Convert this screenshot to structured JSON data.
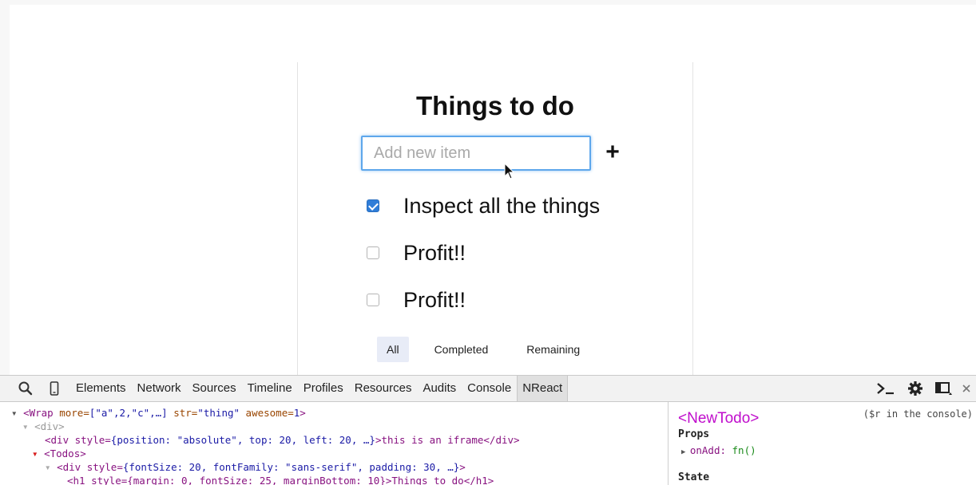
{
  "app": {
    "title": "Things to do",
    "new_item_placeholder": "Add new item",
    "new_item_value": "",
    "add_label": "+",
    "todos": [
      {
        "text": "Inspect all the things",
        "completed": true
      },
      {
        "text": "Profit!!",
        "completed": false
      },
      {
        "text": "Profit!!",
        "completed": false
      }
    ],
    "filters": [
      {
        "label": "All",
        "active": true
      },
      {
        "label": "Completed",
        "active": false
      },
      {
        "label": "Remaining",
        "active": false
      }
    ]
  },
  "devtools": {
    "tabs": [
      "Elements",
      "Network",
      "Sources",
      "Timeline",
      "Profiles",
      "Resources",
      "Audits",
      "Console",
      "NReact"
    ],
    "active_tab": "NReact",
    "tree": {
      "l1_tag": "<Wrap",
      "l1_a1": " more=",
      "l1_v1": "[\"a\",2,\"c\",…]",
      "l1_a2": " str=",
      "l1_v2": "\"thing\"",
      "l1_a3": " awesome=",
      "l1_v3": "1",
      "l1_end": ">",
      "l2": "<div>",
      "l3_open": "<div style=",
      "l3_val": "{position: \"absolute\", top: 20, left: 20, …}",
      "l3_text": ">this is an iframe</div>",
      "l4": "<Todos>",
      "l5_open": "<div style=",
      "l5_val": "{fontSize: 20, fontFamily: \"sans-serif\", padding: 30, …}",
      "l5_end": ">",
      "l6": "<h1 style={margin: 0, fontSize: 25, marginBottom: 10}>Things to do</h1>"
    },
    "side": {
      "component": "<NewTodo>",
      "hint": "($r in the console)",
      "props_label": "Props",
      "prop_key": "onAdd:",
      "prop_value": "fn()",
      "state_label": "State"
    }
  },
  "colors": {
    "accent": "#2f7dd8",
    "input_focus": "#5ea7ec",
    "component": "#c00ecc",
    "tag": "#881280"
  }
}
